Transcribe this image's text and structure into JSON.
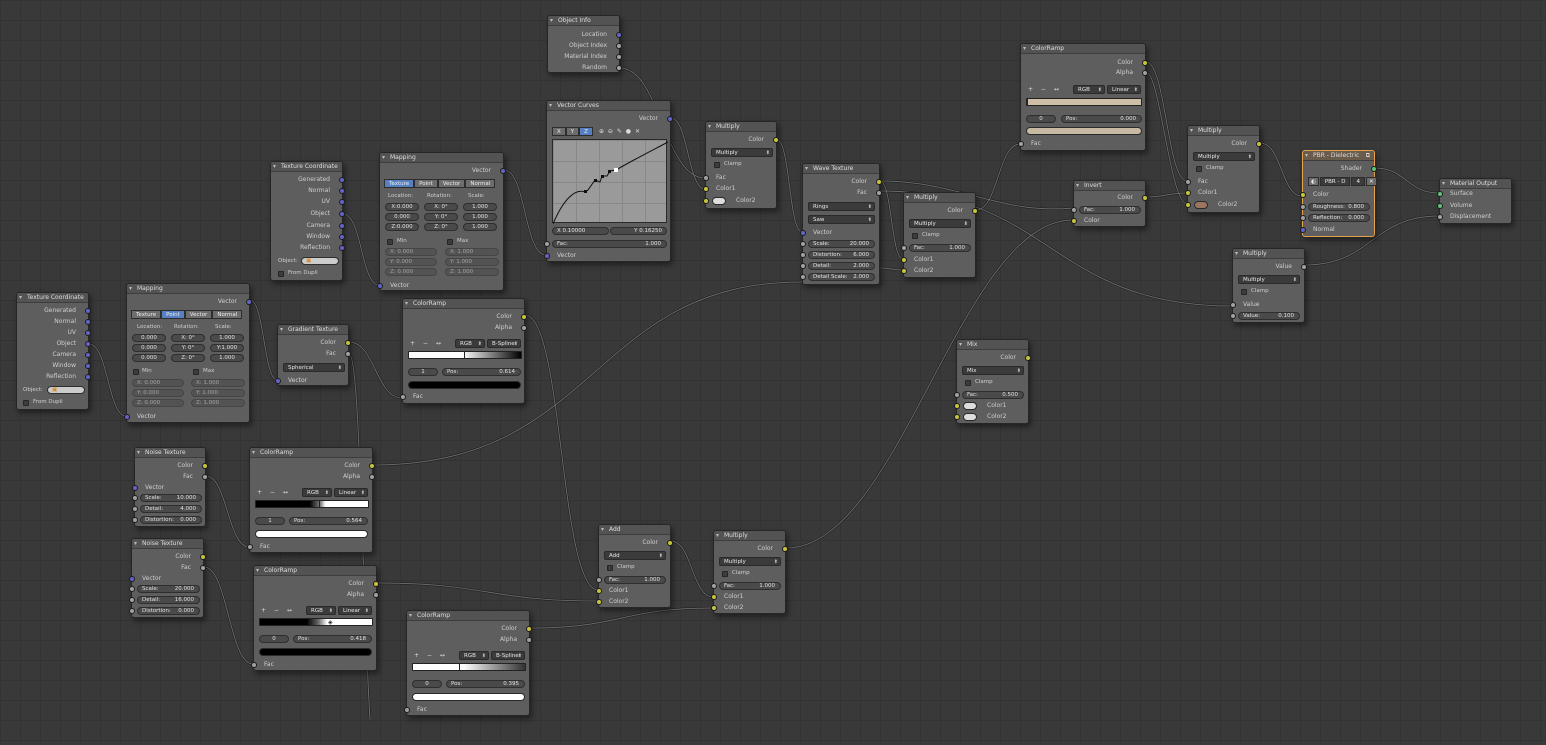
{
  "colors": {
    "socket_color": "#c8c43a",
    "socket_float": "#a1a1a1",
    "socket_vector": "#6363c7",
    "socket_shader": "#5fc27a",
    "selected_outline": "#e6a24a",
    "active_tab": "#5680c2"
  },
  "icons": {
    "collapse": "triangle-down-icon",
    "dropdown": "updown-arrows-icon",
    "object_picker": "cube-icon"
  },
  "nodes": {
    "tc1": {
      "title": "Texture Coordinate",
      "outs": [
        "Generated",
        "Normal",
        "UV",
        "Object",
        "Camera",
        "Window",
        "Reflection"
      ],
      "object_label": "Object:",
      "from_dupli": "From Dupli"
    },
    "tc2": {
      "title": "Texture Coordinate",
      "outs": [
        "Generated",
        "Normal",
        "UV",
        "Object",
        "Camera",
        "Window",
        "Reflection"
      ],
      "object_label": "Object:",
      "from_dupli": "From Dupli"
    },
    "map1": {
      "title": "Mapping",
      "out": "Vector",
      "tabs": [
        "Texture",
        "Point",
        "Vector",
        "Normal"
      ],
      "active_tab": "Point",
      "cols": [
        "Location:",
        "Rotation:",
        "Scale:"
      ],
      "loc": [
        "0.000",
        "0.000",
        "0.000"
      ],
      "rot": [
        "X: 0°",
        "Y: 0°",
        "Z: 0°"
      ],
      "scale": [
        "1.000",
        "Y:1.000",
        "1.000"
      ],
      "min": "Min",
      "max": "Max",
      "min_vals": [
        "X: 0.000",
        "Y: 0.000",
        "Z: 0.000"
      ],
      "max_vals": [
        "X: 1.000",
        "Y: 1.000",
        "Z: 1.000"
      ],
      "in": "Vector"
    },
    "map2": {
      "title": "Mapping",
      "out": "Vector",
      "tabs": [
        "Texture",
        "Point",
        "Vector",
        "Normal"
      ],
      "active_tab": "Texture",
      "cols": [
        "Location:",
        "Rotation:",
        "Scale:"
      ],
      "loc": [
        "X:0.000",
        "0.000",
        "Z:0.000"
      ],
      "rot": [
        "X: 0°",
        "Y: 0°",
        "Z: 0°"
      ],
      "scale": [
        "1.000",
        "1.000",
        "1.000"
      ],
      "min": "Min",
      "max": "Max",
      "min_vals": [
        "X: 0.000",
        "Y: 0.000",
        "Z: 0.000"
      ],
      "max_vals": [
        "X: 1.000",
        "Y: 1.000",
        "Z: 1.000"
      ],
      "in": "Vector"
    },
    "grad": {
      "title": "Gradient Texture",
      "outs": [
        "Color",
        "Fac"
      ],
      "type": "Spherical",
      "in": "Vector"
    },
    "oi": {
      "title": "Object Info",
      "outs": [
        "Location",
        "Object Index",
        "Material Index",
        "Random"
      ]
    },
    "vc": {
      "title": "Vector Curves",
      "out": "Vector",
      "axes": [
        "X",
        "Y",
        "Z"
      ],
      "tools": "⊕ ⊖ ✎ ● ✕",
      "x_readout": "X 0.10000",
      "y_readout": "Y 0.16250",
      "fac_label": "Fac:",
      "fac_val": "1.000",
      "in": "Vector"
    },
    "cr_top": {
      "title": "ColorRamp",
      "outs": [
        "Color",
        "Alpha"
      ],
      "controls": "+ − ↔",
      "mode": "RGB",
      "interp": "B-Spline",
      "index": "1",
      "pos_label": "Pos:",
      "pos": "0.614",
      "in": "Fac"
    },
    "noise1": {
      "title": "Noise Texture",
      "outs": [
        "Color",
        "Fac"
      ],
      "in": "Vector",
      "fields": [
        [
          "Scale:",
          "10.000"
        ],
        [
          "Detail:",
          "4.000"
        ],
        [
          "Distortion:",
          "0.000"
        ]
      ]
    },
    "noise2": {
      "title": "Noise Texture",
      "outs": [
        "Color",
        "Fac"
      ],
      "in": "Vector",
      "fields": [
        [
          "Scale:",
          "20.000"
        ],
        [
          "Detail:",
          "16.000"
        ],
        [
          "Distortion:",
          "0.000"
        ]
      ]
    },
    "cr_l1": {
      "title": "ColorRamp",
      "outs": [
        "Color",
        "Alpha"
      ],
      "controls": "+ − ↔",
      "mode": "RGB",
      "interp": "Linear",
      "index": "1",
      "pos_label": "Pos:",
      "pos": "0.564",
      "in": "Fac"
    },
    "cr_l2": {
      "title": "ColorRamp",
      "outs": [
        "Color",
        "Alpha"
      ],
      "controls": "+ − ↔",
      "mode": "RGB",
      "interp": "Linear",
      "index": "0",
      "pos_label": "Pos:",
      "pos": "0.418",
      "in": "Fac"
    },
    "cr_bot": {
      "title": "ColorRamp",
      "outs": [
        "Color",
        "Alpha"
      ],
      "controls": "+ − ↔",
      "mode": "RGB",
      "interp": "B-Spline",
      "index": "0",
      "pos_label": "Pos:",
      "pos": "0.395",
      "in": "Fac"
    },
    "add": {
      "title": "Add",
      "out": "Color",
      "op": "Add",
      "clamp": "Clamp",
      "fac_label": "Fac:",
      "fac": "1.000",
      "ins": [
        "Color1",
        "Color2"
      ]
    },
    "mul_bot": {
      "title": "Multiply",
      "out": "Color",
      "op": "Multiply",
      "clamp": "Clamp",
      "fac_label": "Fac:",
      "fac": "1.000",
      "ins": [
        "Color1",
        "Color2"
      ]
    },
    "mul_top": {
      "title": "Multiply",
      "out": "Color",
      "op": "Multiply",
      "clamp": "Clamp",
      "ins": [
        "Fac",
        "Color1",
        "Color2"
      ]
    },
    "wave": {
      "title": "Wave Texture",
      "outs": [
        "Color",
        "Fac"
      ],
      "type": "Rings",
      "profile": "Saw",
      "in": "Vector",
      "fields": [
        [
          "Scale:",
          "20.000"
        ],
        [
          "Distortion:",
          "6.000"
        ],
        [
          "Detail:",
          "2.000"
        ],
        [
          "Detail Scale:",
          "2.000"
        ]
      ]
    },
    "mul_mid": {
      "title": "Multiply",
      "out": "Color",
      "op": "Multiply",
      "clamp": "Clamp",
      "fac_label": "Fac:",
      "fac": "1.000",
      "ins": [
        "Color1",
        "Color2"
      ]
    },
    "mix": {
      "title": "Mix",
      "out": "Color",
      "op": "Mix",
      "clamp": "Clamp",
      "fac_label": "Fac:",
      "fac": "0.500",
      "ins": [
        "Color1",
        "Color2"
      ]
    },
    "cr_tr": {
      "title": "ColorRamp",
      "outs": [
        "Color",
        "Alpha"
      ],
      "controls": "+ − ↔",
      "mode": "RGB",
      "interp": "Linear",
      "index": "0",
      "pos_label": "Pos:",
      "pos": "0.000",
      "in": "Fac"
    },
    "inv": {
      "title": "Invert",
      "out": "Color",
      "fac_label": "Fac:",
      "fac": "1.000",
      "in": "Color"
    },
    "mul_r1": {
      "title": "Multiply",
      "out": "Color",
      "op": "Multiply",
      "clamp": "Clamp",
      "ins": [
        "Fac",
        "Color1",
        "Color2"
      ]
    },
    "mul_r2": {
      "title": "Multiply",
      "out": "Value",
      "op": "Multiply",
      "clamp": "Clamp",
      "in": "Value",
      "val_label": "Value:",
      "val": "0.100"
    },
    "pbr": {
      "title": "PBR - Dielectric",
      "out": "Shader",
      "group_name": "PBR - D",
      "users": "4",
      "in_color": "Color",
      "fields": [
        [
          "Roughness:",
          "0.800"
        ],
        [
          "Reflection:",
          "0.000"
        ]
      ],
      "in_normal": "Normal"
    },
    "out": {
      "title": "Material Output",
      "ins": [
        "Surface",
        "Volume",
        "Displacement"
      ]
    }
  }
}
